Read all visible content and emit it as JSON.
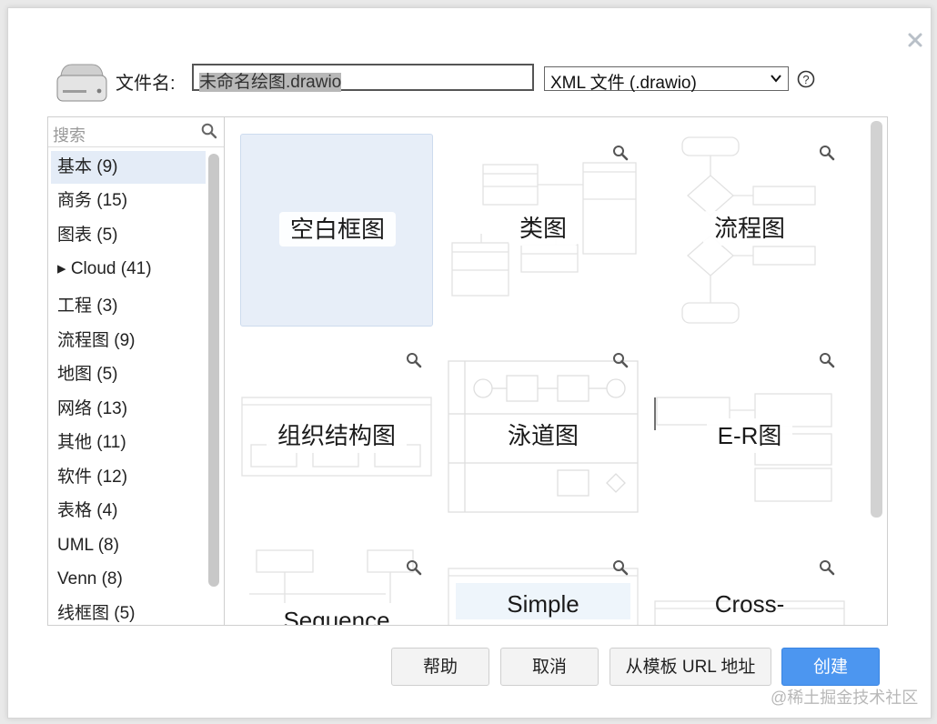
{
  "dialog": {
    "filename_label": "文件名:",
    "filename_value": "未命名绘图.drawio",
    "filetype_value": "XML 文件 (.drawio)",
    "icons": {
      "close": "close-icon",
      "drive": "drive-icon",
      "help": "help-icon",
      "search": "search-icon",
      "zoom": "zoom-icon"
    }
  },
  "sidebar": {
    "search_placeholder": "搜索",
    "categories": [
      {
        "label": "基本 (9)"
      },
      {
        "label": "商务 (15)"
      },
      {
        "label": "图表 (5)"
      },
      {
        "label": "▸ Cloud (41)"
      },
      {
        "label": "工程 (3)"
      },
      {
        "label": "流程图 (9)"
      },
      {
        "label": "地图 (5)"
      },
      {
        "label": "网络 (13)"
      },
      {
        "label": "其他 (11)"
      },
      {
        "label": "软件 (12)"
      },
      {
        "label": "表格 (4)"
      },
      {
        "label": "UML (8)"
      },
      {
        "label": "Venn (8)"
      },
      {
        "label": "线框图 (5)"
      }
    ]
  },
  "templates": [
    {
      "label": "空白框图"
    },
    {
      "label": "类图"
    },
    {
      "label": "流程图"
    },
    {
      "label": "组织结构图"
    },
    {
      "label": "泳道图"
    },
    {
      "label": "E-R图"
    },
    {
      "label": "Sequence"
    },
    {
      "label": "Simple"
    },
    {
      "label": "Cross-"
    }
  ],
  "buttons": {
    "help": "帮助",
    "cancel": "取消",
    "from_url": "从模板 URL 地址",
    "create": "创建"
  },
  "watermark": "@稀土掘金技术社区",
  "colors": {
    "primary": "#4c96f0",
    "selected_bg": "#e7eef8"
  }
}
